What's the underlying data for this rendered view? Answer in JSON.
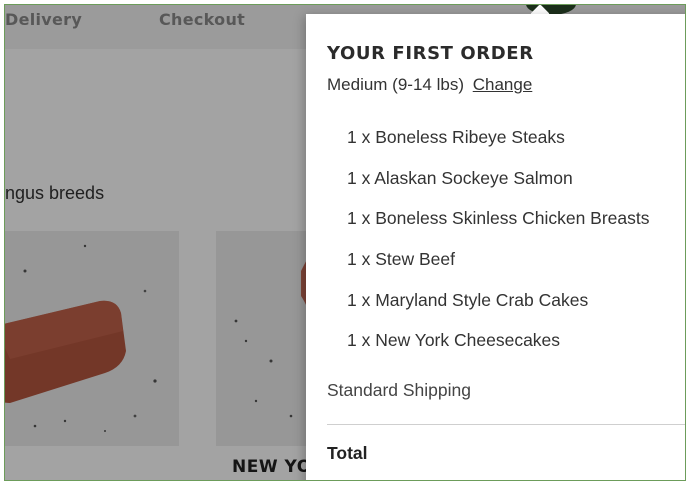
{
  "nav": {
    "delivery_label": "Delivery",
    "checkout_label": "Checkout"
  },
  "page": {
    "subtitle": "ngus breeds",
    "card_title": "NEW YO"
  },
  "order": {
    "title": "YOUR FIRST ORDER",
    "size_label": "Medium (9-14 lbs)",
    "change_label": "Change",
    "items": [
      "1 x Boneless Ribeye Steaks",
      "1 x Alaskan Sockeye Salmon",
      "1 x Boneless Skinless Chicken Breasts",
      "1 x Stew Beef",
      "1 x Maryland Style Crab Cakes",
      "1 x New York Cheesecakes"
    ],
    "shipping_label": "Standard Shipping",
    "total_label": "Total"
  },
  "colors": {
    "overlay": "#000000",
    "frame": "#6c9c5a",
    "meat": "#b5563f"
  }
}
